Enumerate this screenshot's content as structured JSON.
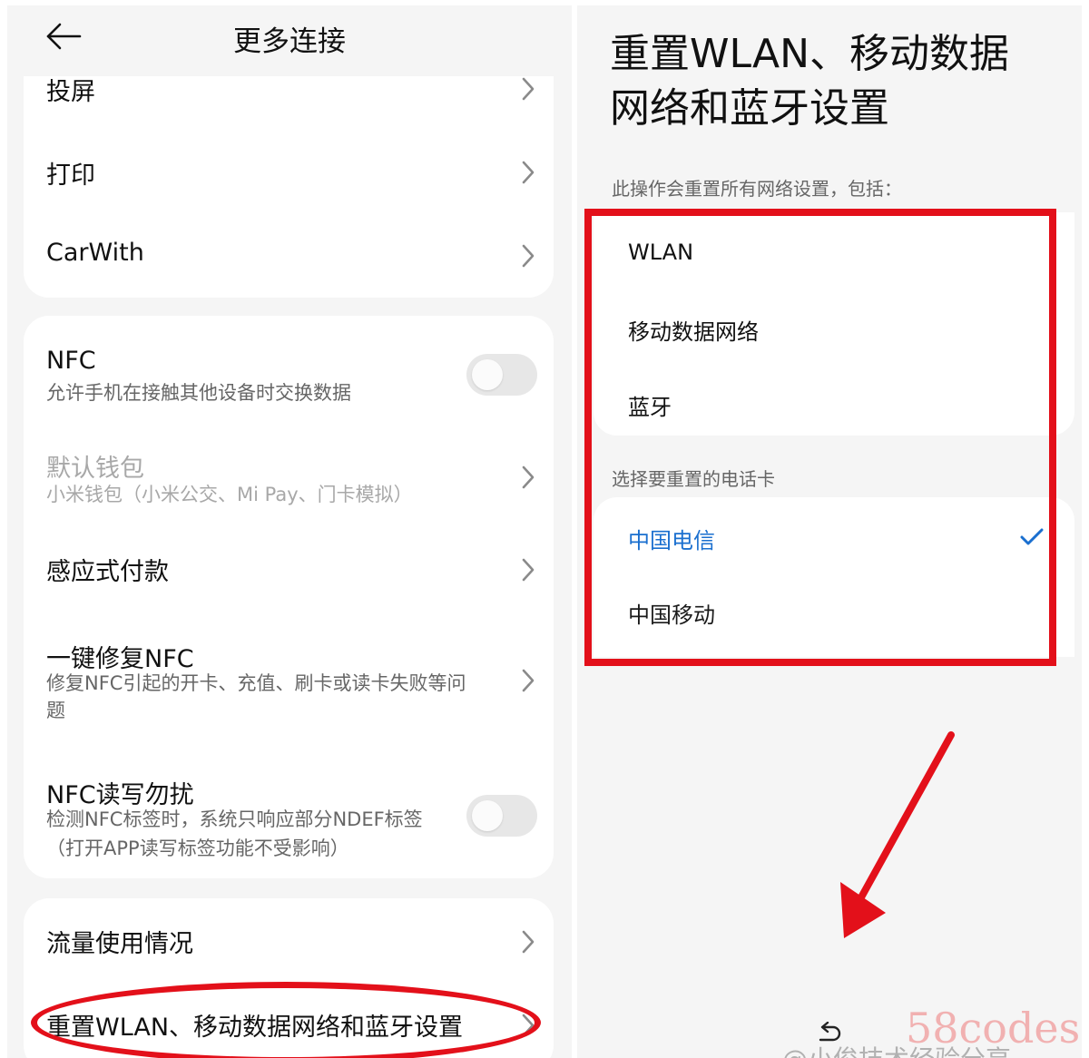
{
  "left": {
    "header": {
      "title": "更多连接"
    },
    "group1": [
      {
        "title": "投屏"
      },
      {
        "title": "打印"
      },
      {
        "title": "CarWith"
      }
    ],
    "nfc": {
      "title": "NFC",
      "subtitle": "允许手机在接触其他设备时交换数据",
      "toggle_on": false
    },
    "wallet": {
      "title": "默认钱包",
      "subtitle": "小米钱包（小米公交、Mi Pay、门卡模拟）",
      "disabled": true
    },
    "tap_pay": {
      "title": "感应式付款"
    },
    "repair_nfc": {
      "title": "一键修复NFC",
      "subtitle_line1": "修复NFC引起的开卡、充值、刷卡或读卡失败等问",
      "subtitle_line2": "题"
    },
    "nfc_dnd": {
      "title": "NFC读写勿扰",
      "subtitle_line1": "检测NFC标签时，系统只响应部分NDEF标签",
      "subtitle_line2": "（打开APP读写标签功能不受影响）",
      "toggle_on": false
    },
    "data_usage": {
      "title": "流量使用情况"
    },
    "reset": {
      "title": "重置WLAN、移动数据网络和蓝牙设置"
    }
  },
  "right": {
    "title_line1": "重置WLAN、移动数据",
    "title_line2": "网络和蓝牙设置",
    "description": "此操作会重置所有网络设置，包括：",
    "items": [
      "WLAN",
      "移动数据网络",
      "蓝牙"
    ],
    "sim_label": "选择要重置的电话卡",
    "sims": [
      {
        "name": "中国电信",
        "selected": true
      },
      {
        "name": "中国移动",
        "selected": false
      }
    ]
  },
  "watermark": {
    "text": "58codes",
    "text2": "@小俊技术经验分享"
  },
  "colors": {
    "accent": "#1a6fcf",
    "annotation_red": "#e3101a",
    "background": "#f5f5f5",
    "card": "#ffffff"
  },
  "icons": {
    "back": "arrow-left-icon",
    "chevron": "chevron-right-icon",
    "check": "checkmark-icon",
    "nav_back": "return-icon"
  }
}
